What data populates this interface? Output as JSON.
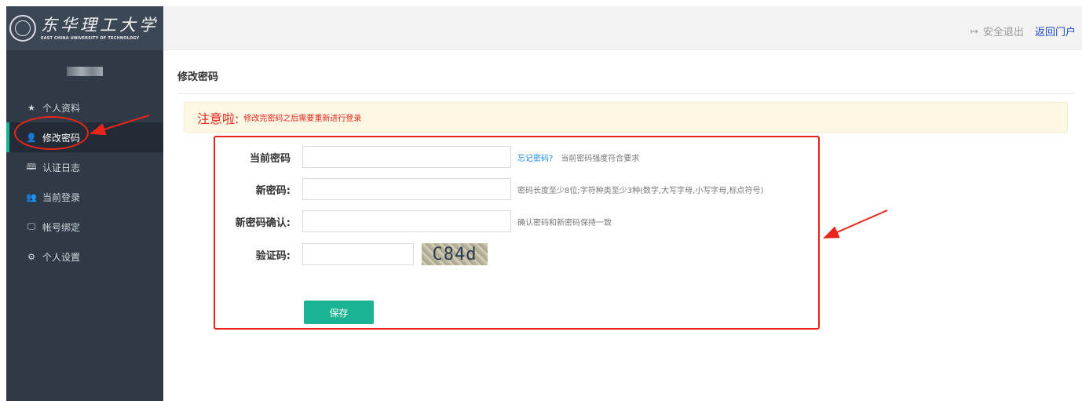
{
  "logo": {
    "name_cn": "东华理工大学",
    "name_en": "EAST CHINA UNIVERSITY OF TECHNOLOGY"
  },
  "sidebar": {
    "items": [
      {
        "icon": "star-icon",
        "glyph": "★",
        "label": "个人资料"
      },
      {
        "icon": "user-icon",
        "glyph": "👤",
        "label": "修改密码",
        "active": true
      },
      {
        "icon": "book-icon",
        "glyph": "🕮",
        "label": "认证日志"
      },
      {
        "icon": "users-icon",
        "glyph": "👥",
        "label": "当前登录"
      },
      {
        "icon": "monitor-icon",
        "glyph": "🖵",
        "label": "帐号绑定"
      },
      {
        "icon": "gear-icon",
        "glyph": "⚙",
        "label": "个人设置"
      }
    ]
  },
  "header": {
    "logout_label": "安全退出",
    "portal_label": "返回门户"
  },
  "page": {
    "title": "修改密码"
  },
  "alert": {
    "title": "注意啦:",
    "message": "修改完密码之后需要重新进行登录"
  },
  "form": {
    "current_password": {
      "label": "当前密码",
      "value": "",
      "forgot_label": "忘记密码?",
      "hint": "当前密码强度符合要求"
    },
    "new_password": {
      "label": "新密码:",
      "value": "",
      "hint": "密码长度至少8位;字符种类至少3种(数字,大写字母,小写字母,标点符号)"
    },
    "confirm_password": {
      "label": "新密码确认:",
      "value": "",
      "hint": "确认密码和新密码保持一致"
    },
    "captcha": {
      "label": "验证码:",
      "value": "",
      "image_text": "C84d"
    },
    "save_label": "保存"
  },
  "colors": {
    "sidebar_bg": "#2f3a46",
    "accent": "#1ab394",
    "annotation": "#e8251b",
    "alert_bg": "#fcf8e3",
    "link": "#1c47c9"
  }
}
